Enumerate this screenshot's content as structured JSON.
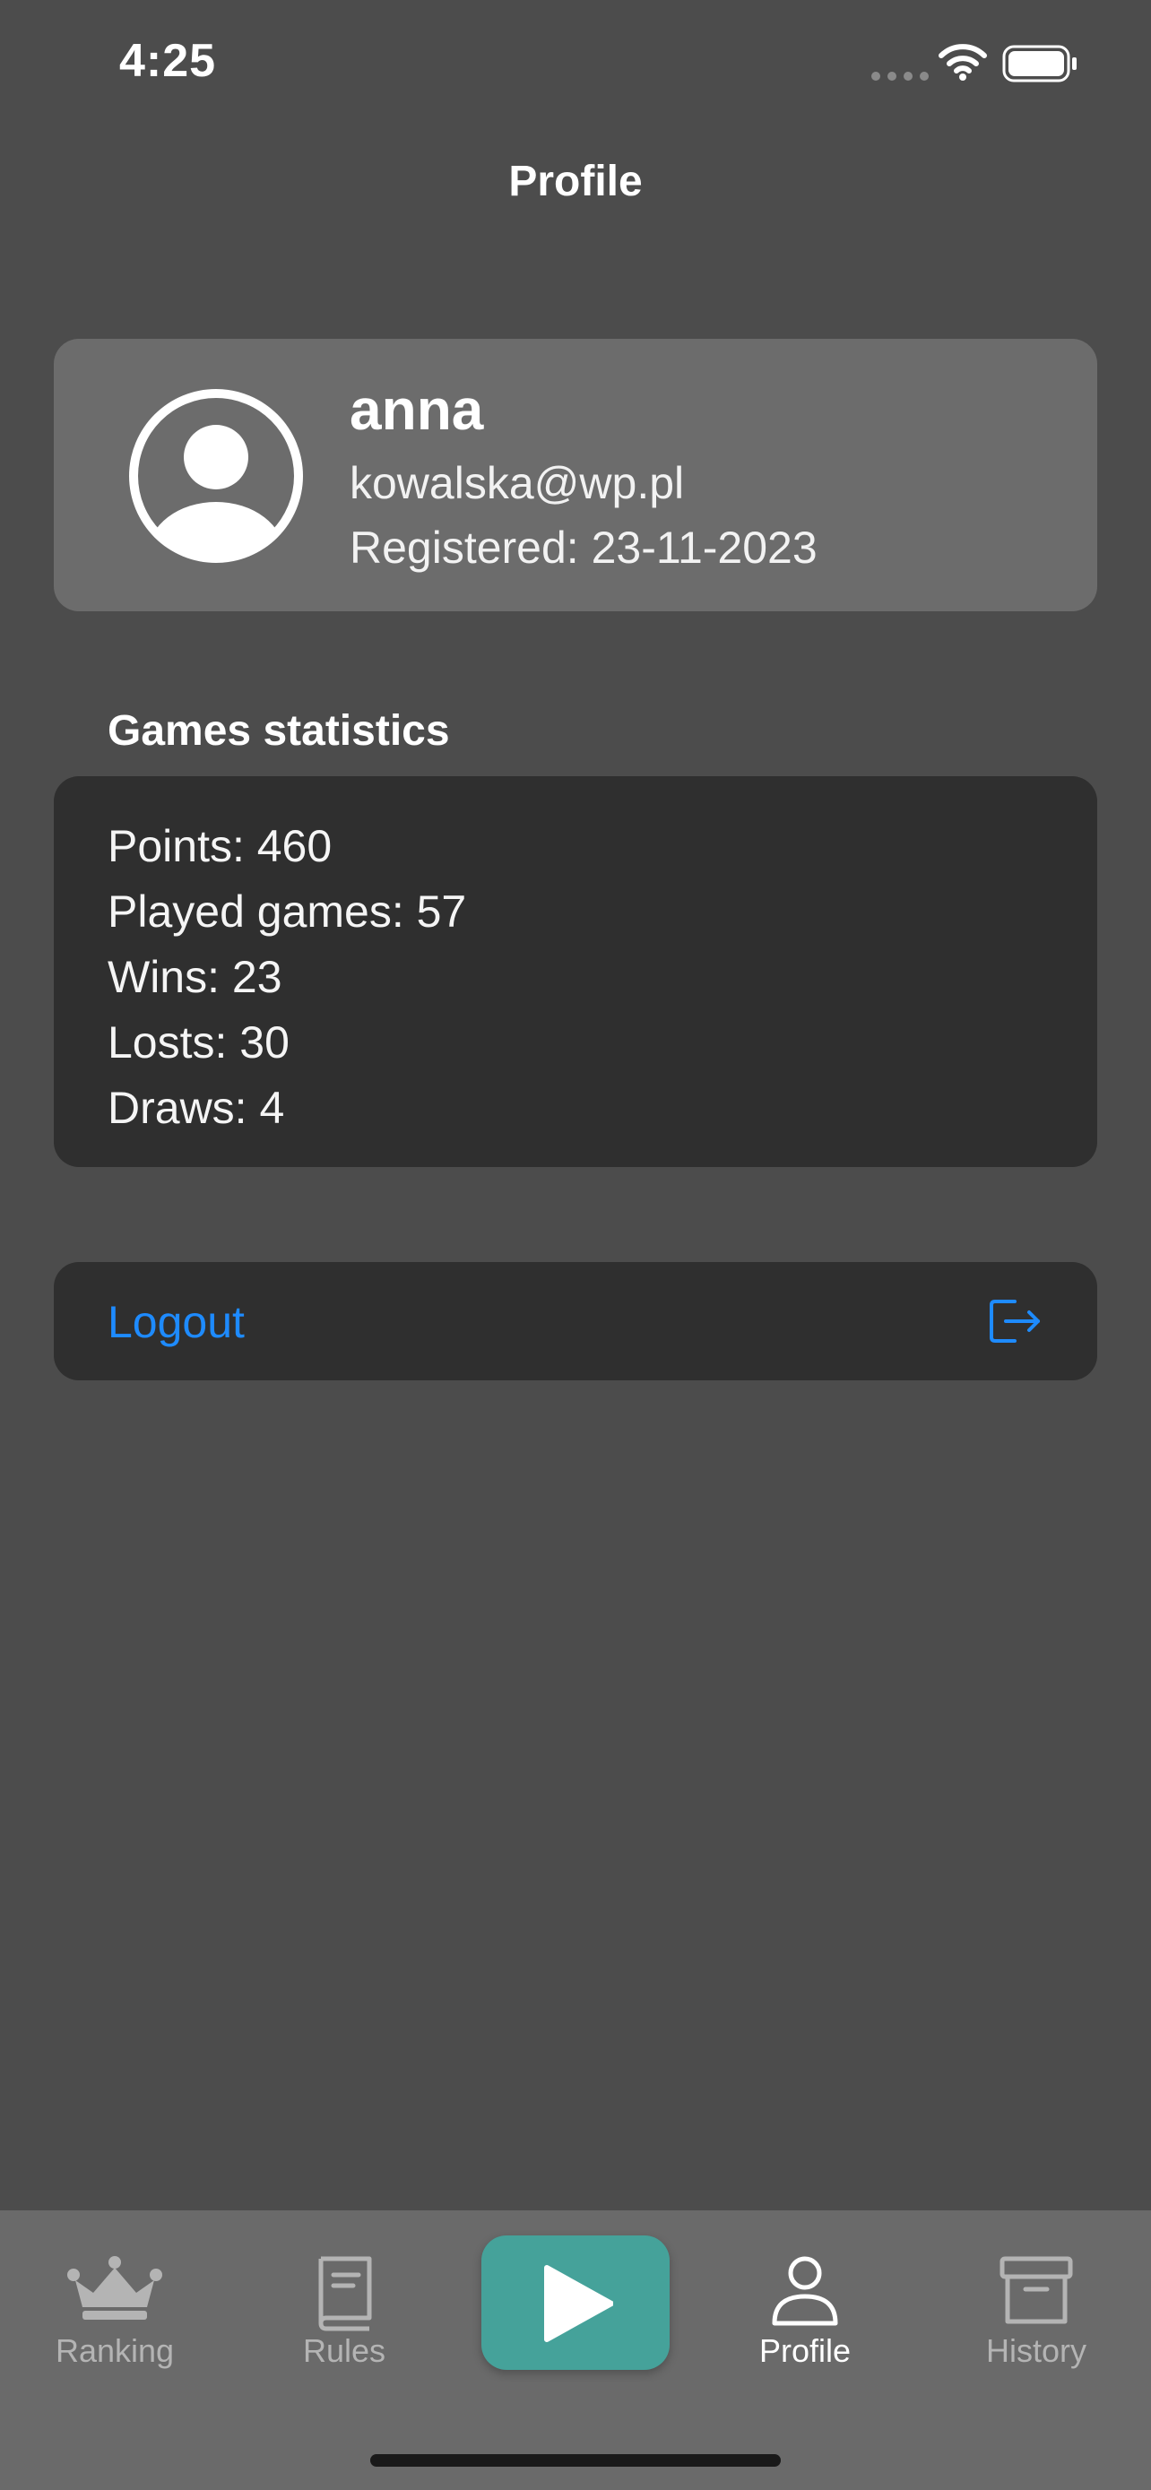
{
  "status_bar": {
    "time": "4:25",
    "wifi_icon": "wifi-icon",
    "battery_icon": "battery-icon"
  },
  "nav": {
    "title": "Profile"
  },
  "profile": {
    "avatar_icon": "person-circle-icon",
    "name": "anna",
    "email": "kowalska@wp.pl",
    "registered": "Registered: 23-11-2023"
  },
  "stats": {
    "header": "Games statistics",
    "lines": [
      "Points: 460",
      "Played games: 57",
      "Wins: 23",
      "Losts: 30",
      "Draws: 4"
    ]
  },
  "logout": {
    "label": "Logout",
    "icon": "logout-arrow-icon",
    "color": "#1e8bff"
  },
  "tab_bar": {
    "tabs": [
      {
        "label": "Ranking",
        "icon": "crown-icon",
        "active": false
      },
      {
        "label": "Rules",
        "icon": "book-icon",
        "active": false
      },
      {
        "label": "Profile",
        "icon": "person-icon",
        "active": true
      },
      {
        "label": "History",
        "icon": "archive-box-icon",
        "active": false
      }
    ],
    "play_button": {
      "icon": "play-icon",
      "color": "#45a29a"
    }
  },
  "colors": {
    "background": "#4c4c4c",
    "profile_card": "#6c6c6c",
    "stats_card": "#2f2f2f",
    "tab_bar": "#6a6a6a",
    "inactive_tab": "#b4b4b4",
    "active_tab": "#ffffff"
  }
}
